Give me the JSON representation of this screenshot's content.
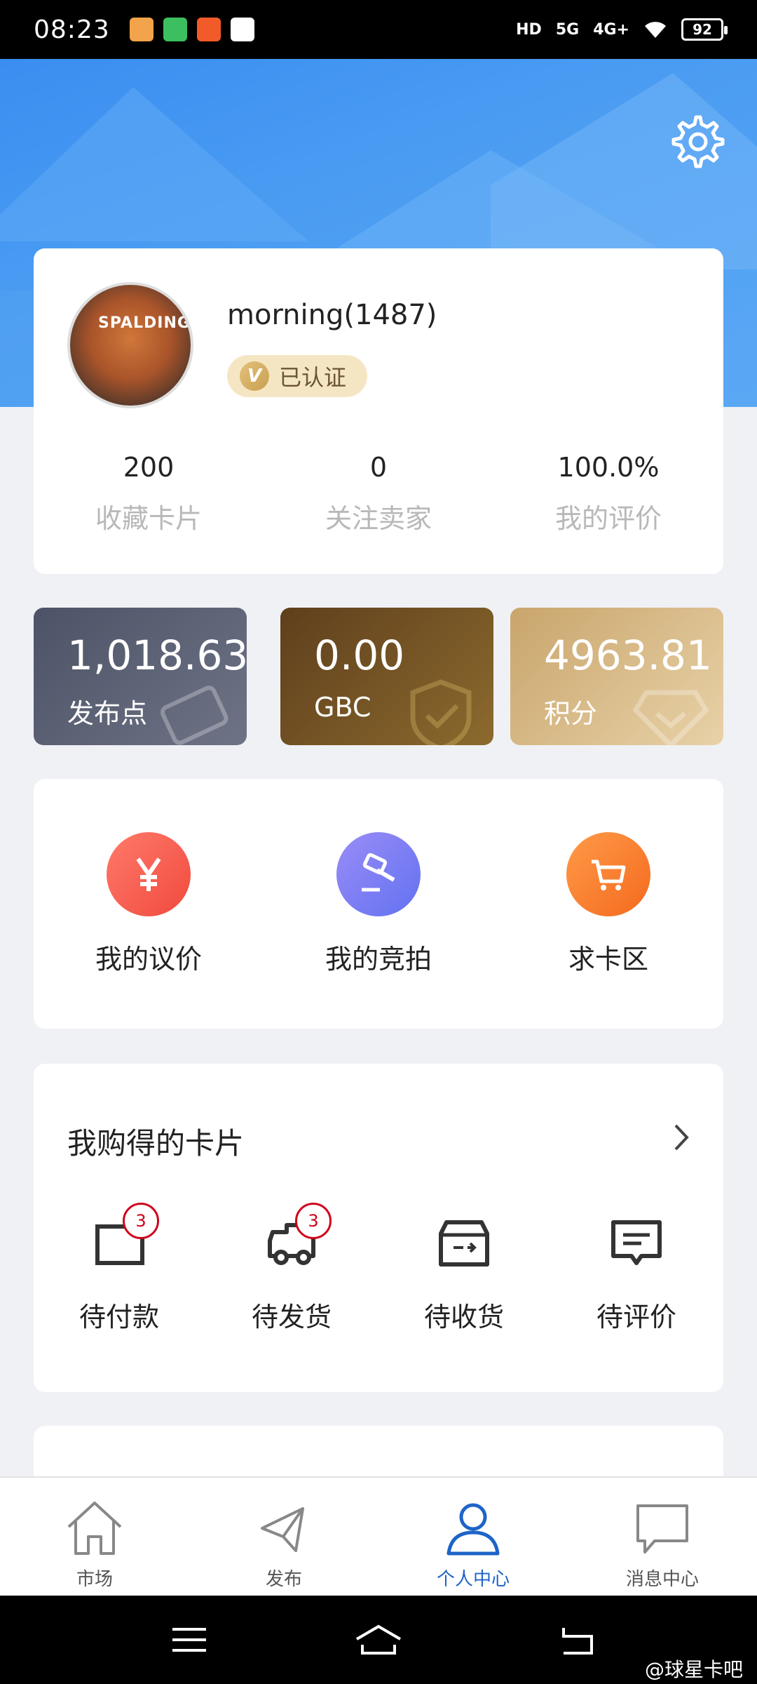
{
  "status_bar": {
    "time": "08:23",
    "network_hd": "HD",
    "network_5g": "5G",
    "network_4g": "4G+",
    "battery": "92"
  },
  "profile": {
    "username": "morning(1487)",
    "verified_label": "已认证",
    "verified_icon_letter": "V",
    "avatar_text": "SPALDING",
    "stats": [
      {
        "value": "200",
        "label": "收藏卡片"
      },
      {
        "value": "0",
        "label": "关注卖家"
      },
      {
        "value": "100.0%",
        "label": "我的评价"
      }
    ]
  },
  "balances": [
    {
      "value": "1,018.63",
      "label": "发布点"
    },
    {
      "value": "0.00",
      "label": "GBC"
    },
    {
      "value": "4963.81",
      "label": "积分"
    }
  ],
  "quick_actions": [
    {
      "label": "我的议价",
      "icon": "yen-icon",
      "color": "#f65f52"
    },
    {
      "label": "我的竞拍",
      "icon": "gavel-icon",
      "color": "#7c7ef5"
    },
    {
      "label": "求卡区",
      "icon": "cart-icon",
      "color": "#fb7d2f"
    }
  ],
  "orders": {
    "title": "我购得的卡片",
    "items": [
      {
        "label": "待付款",
        "badge": "3"
      },
      {
        "label": "待发货",
        "badge": "3"
      },
      {
        "label": "待收货",
        "badge": ""
      },
      {
        "label": "待评价",
        "badge": ""
      }
    ]
  },
  "bottom_nav": [
    {
      "label": "市场",
      "icon": "home-icon"
    },
    {
      "label": "发布",
      "icon": "paper-plane-icon"
    },
    {
      "label": "个人中心",
      "icon": "user-icon",
      "active": true
    },
    {
      "label": "消息中心",
      "icon": "chat-icon"
    }
  ],
  "watermark": "@球星卡吧",
  "colors": {
    "accent": "#1e64c8",
    "header_blue": "#4a9cf2",
    "badge_red": "#d0021b"
  }
}
